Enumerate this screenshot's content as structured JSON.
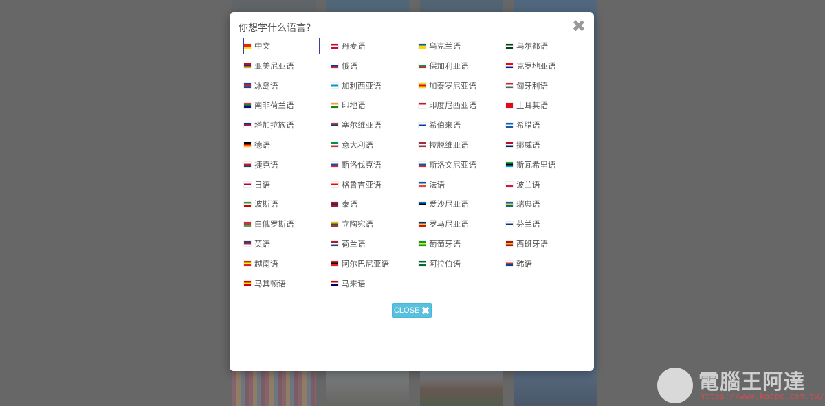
{
  "modal": {
    "title": "你想学什么语言?",
    "close_icon": "✖",
    "close_button_label": "CLOSE",
    "close_button_icon": "✖"
  },
  "languages": [
    {
      "name": "中文",
      "flag": [
        "#de2910",
        "#de2910",
        "#ffde00"
      ],
      "selected": true
    },
    {
      "name": "丹麦语",
      "flag": [
        "#c60c30",
        "#ffffff",
        "#c60c30"
      ]
    },
    {
      "name": "乌克兰语",
      "flag": [
        "#0057b7",
        "#ffd700",
        "#ffd700"
      ]
    },
    {
      "name": "乌尔都语",
      "flag": [
        "#01411c",
        "#ffffff",
        "#01411c"
      ]
    },
    {
      "name": "亚美尼亚语",
      "flag": [
        "#d90012",
        "#0033a0",
        "#f2a800"
      ]
    },
    {
      "name": "俄语",
      "flag": [
        "#ffffff",
        "#0039a6",
        "#d52b1e"
      ]
    },
    {
      "name": "保加利亚语",
      "flag": [
        "#ffffff",
        "#00966e",
        "#d62612"
      ]
    },
    {
      "name": "克罗地亚语",
      "flag": [
        "#ff0000",
        "#ffffff",
        "#171796"
      ]
    },
    {
      "name": "冰岛语",
      "flag": [
        "#02529c",
        "#dc1e35",
        "#02529c"
      ]
    },
    {
      "name": "加利西亚语",
      "flag": [
        "#ffffff",
        "#0099cc",
        "#ffffff"
      ]
    },
    {
      "name": "加泰罗尼亚语",
      "flag": [
        "#fcdd09",
        "#da121a",
        "#fcdd09"
      ]
    },
    {
      "name": "匈牙利语",
      "flag": [
        "#ce2939",
        "#ffffff",
        "#477050"
      ]
    },
    {
      "name": "南非荷兰语",
      "flag": [
        "#e03c31",
        "#007749",
        "#001489"
      ]
    },
    {
      "name": "印地语",
      "flag": [
        "#ff9933",
        "#ffffff",
        "#138808"
      ]
    },
    {
      "name": "印度尼西亚语",
      "flag": [
        "#ce1126",
        "#ffffff",
        "#ffffff"
      ]
    },
    {
      "name": "土耳其语",
      "flag": [
        "#e30a17",
        "#e30a17",
        "#e30a17"
      ]
    },
    {
      "name": "塔加拉族语",
      "flag": [
        "#0038a8",
        "#ce1126",
        "#ffffff"
      ]
    },
    {
      "name": "塞尔维亚语",
      "flag": [
        "#c6363c",
        "#0c4076",
        "#ffffff"
      ]
    },
    {
      "name": "希伯来语",
      "flag": [
        "#ffffff",
        "#0038b8",
        "#ffffff"
      ]
    },
    {
      "name": "希腊语",
      "flag": [
        "#0d5eaf",
        "#ffffff",
        "#0d5eaf"
      ]
    },
    {
      "name": "德语",
      "flag": [
        "#000000",
        "#dd0000",
        "#ffce00"
      ]
    },
    {
      "name": "意大利语",
      "flag": [
        "#009246",
        "#ffffff",
        "#ce2b37"
      ]
    },
    {
      "name": "拉脱维亚语",
      "flag": [
        "#9e3039",
        "#ffffff",
        "#9e3039"
      ]
    },
    {
      "name": "挪威语",
      "flag": [
        "#ba0c2f",
        "#ffffff",
        "#00205b"
      ]
    },
    {
      "name": "捷克语",
      "flag": [
        "#ffffff",
        "#d7141a",
        "#11457e"
      ]
    },
    {
      "name": "斯洛伐克语",
      "flag": [
        "#ffffff",
        "#0b4ea2",
        "#ee1c25"
      ]
    },
    {
      "name": "斯洛文尼亚语",
      "flag": [
        "#ffffff",
        "#005da4",
        "#ed1c24"
      ]
    },
    {
      "name": "斯瓦希里语",
      "flag": [
        "#1eb53a",
        "#000000",
        "#00a3dd"
      ]
    },
    {
      "name": "日语",
      "flag": [
        "#ffffff",
        "#bc002d",
        "#ffffff"
      ]
    },
    {
      "name": "格鲁吉亚语",
      "flag": [
        "#ffffff",
        "#ff0000",
        "#ffffff"
      ]
    },
    {
      "name": "法语",
      "flag": [
        "#0055a4",
        "#ffffff",
        "#ef4135"
      ]
    },
    {
      "name": "波兰语",
      "flag": [
        "#ffffff",
        "#ffffff",
        "#dc143c"
      ]
    },
    {
      "name": "波斯语",
      "flag": [
        "#239f40",
        "#ffffff",
        "#da0000"
      ]
    },
    {
      "name": "泰语",
      "flag": [
        "#a51931",
        "#2d2a4a",
        "#a51931"
      ]
    },
    {
      "name": "爱沙尼亚语",
      "flag": [
        "#0072ce",
        "#000000",
        "#ffffff"
      ]
    },
    {
      "name": "瑞典语",
      "flag": [
        "#006aa7",
        "#fecc00",
        "#006aa7"
      ]
    },
    {
      "name": "白俄罗斯语",
      "flag": [
        "#c8313e",
        "#c8313e",
        "#4aa657"
      ]
    },
    {
      "name": "立陶宛语",
      "flag": [
        "#fdb913",
        "#006a44",
        "#c1272d"
      ]
    },
    {
      "name": "罗马尼亚语",
      "flag": [
        "#002b7f",
        "#fcd116",
        "#ce1126"
      ]
    },
    {
      "name": "芬兰语",
      "flag": [
        "#ffffff",
        "#003580",
        "#ffffff"
      ]
    },
    {
      "name": "英语",
      "flag": [
        "#3c3b6e",
        "#b22234",
        "#ffffff"
      ]
    },
    {
      "name": "荷兰语",
      "flag": [
        "#ae1c28",
        "#ffffff",
        "#21468b"
      ]
    },
    {
      "name": "葡萄牙语",
      "flag": [
        "#009c3b",
        "#ffdf00",
        "#009c3b"
      ]
    },
    {
      "name": "西班牙语",
      "flag": [
        "#aa151b",
        "#f1bf00",
        "#aa151b"
      ]
    },
    {
      "name": "越南语",
      "flag": [
        "#da251d",
        "#ffff00",
        "#da251d"
      ]
    },
    {
      "name": "阿尔巴尼亚语",
      "flag": [
        "#e41e20",
        "#000000",
        "#e41e20"
      ]
    },
    {
      "name": "阿拉伯语",
      "flag": [
        "#006c35",
        "#ffffff",
        "#006c35"
      ]
    },
    {
      "name": "韩语",
      "flag": [
        "#ffffff",
        "#cd2e3a",
        "#0047a0"
      ]
    },
    {
      "name": "马其顿语",
      "flag": [
        "#d20000",
        "#ffe600",
        "#d20000"
      ]
    },
    {
      "name": "马来语",
      "flag": [
        "#cc0001",
        "#ffffff",
        "#010066"
      ]
    }
  ],
  "watermark": {
    "brand": "電腦王阿達",
    "url": "https://www.kocpc.com.tw/"
  }
}
